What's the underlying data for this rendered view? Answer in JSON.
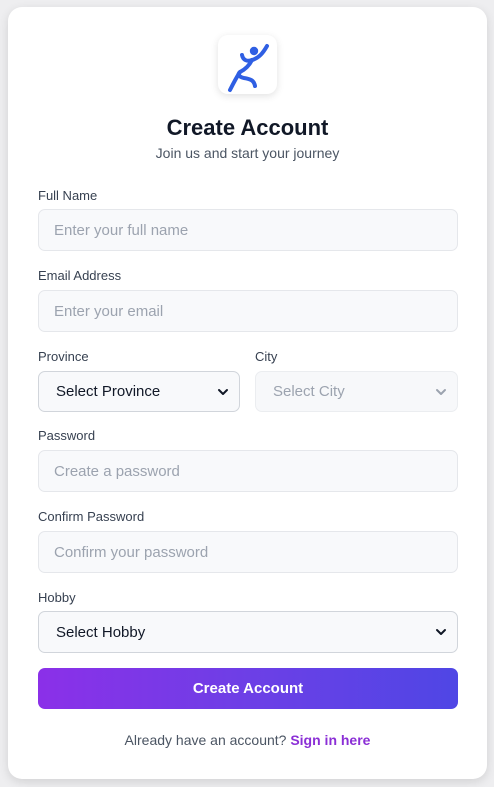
{
  "header": {
    "title": "Create Account",
    "subtitle": "Join us and start your journey",
    "logo_icon": "person-jumping-icon",
    "logo_color": "#2f5fe3"
  },
  "form": {
    "full_name": {
      "label": "Full Name",
      "placeholder": "Enter your full name",
      "value": ""
    },
    "email": {
      "label": "Email Address",
      "placeholder": "Enter your email",
      "value": ""
    },
    "province": {
      "label": "Province",
      "selected": "Select Province"
    },
    "city": {
      "label": "City",
      "selected": "Select City",
      "disabled": true
    },
    "password": {
      "label": "Password",
      "placeholder": "Create a password",
      "value": ""
    },
    "confirm_password": {
      "label": "Confirm Password",
      "placeholder": "Confirm your password",
      "value": ""
    },
    "hobby": {
      "label": "Hobby",
      "selected": "Select Hobby"
    }
  },
  "submit": {
    "label": "Create Account",
    "gradient_start": "#8b30e8",
    "gradient_end": "#4f46e5"
  },
  "footer": {
    "text": "Already have an account?",
    "link_label": "Sign in here",
    "link_color": "#8b2fd6"
  }
}
